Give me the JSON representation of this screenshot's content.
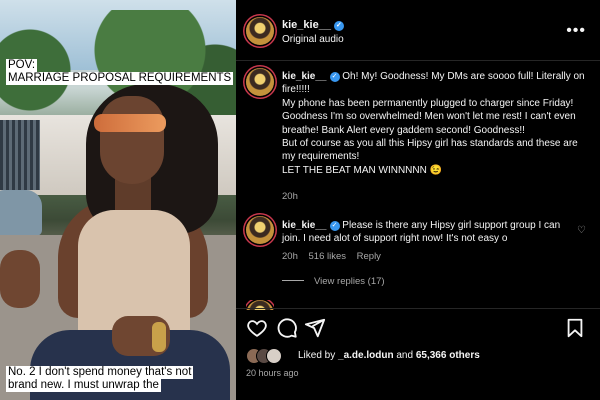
{
  "video": {
    "caption_top": [
      "POV:",
      "MARRIAGE PROPOSAL REQUIREMENTS"
    ],
    "caption_bottom": [
      "No. 2 I don't spend money that's not",
      "brand new. I must unwrap the"
    ]
  },
  "header": {
    "username": "kie_kie__",
    "audio": "Original audio",
    "more_icon": "more-horizontal-icon"
  },
  "comments": [
    {
      "username": "kie_kie__",
      "text_lines": [
        "Oh! My! Goodness! My DMs are soooo full! Literally on fire!!!!!",
        "My phone has been permanently plugged to charger since Friday! Goodness I'm so overwhelmed! Men won't let me rest! I can't even breathe! Bank Alert every gaddem second! Goodness!!",
        "But of course as you all this Hipsy girl has standards and these are my requirements!",
        "LET THE BEAT MAN WINNNNN 😉"
      ],
      "time": "20h"
    },
    {
      "username": "kie_kie__",
      "text": "Please is there any Hipsy girl support group I can join. I need alot of support right now! It's not easy o",
      "time": "20h",
      "likes": "516 likes",
      "reply": "Reply",
      "view_replies": "View replies (17)"
    }
  ],
  "actions": {
    "icons": [
      "heart-icon",
      "comment-icon",
      "share-icon",
      "bookmark-icon"
    ]
  },
  "likes": {
    "prefix": "Liked by",
    "user": "_a.de.lodun",
    "connector": "and",
    "others": "65,366 others"
  },
  "time_ago": "20 hours ago",
  "colors": {
    "background": "#000000",
    "text": "#f5f5f5",
    "muted": "#a8a8a8",
    "verified": "#3897f0",
    "story_ring": "#c8384d"
  }
}
